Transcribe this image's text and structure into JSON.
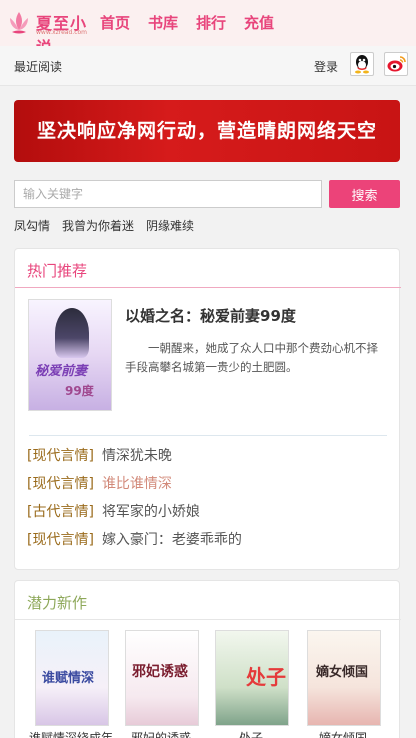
{
  "header": {
    "logo_text": "夏至小说",
    "logo_sub": "www.xzread.com",
    "nav": [
      "首页",
      "书库",
      "排行",
      "充值"
    ]
  },
  "subbar": {
    "recent": "最近阅读",
    "login": "登录"
  },
  "banner": {
    "text": "坚决响应净网行动，营造晴朗网络天空"
  },
  "search": {
    "placeholder": "输入关键字",
    "button": "搜索",
    "hot_tags": [
      "凤勾情",
      "我曾为你着迷",
      "阴缘难续"
    ]
  },
  "recommend": {
    "title": "热门推荐",
    "featured": {
      "title": "以婚之名：秘爱前妻99度",
      "desc": "一朝醒来，她成了众人口中那个费劲心机不择手段高攀名城第一贵少的土肥圆。",
      "cover_title": "秘爱前妻",
      "cover_sub": "99度"
    },
    "list": [
      {
        "cat": "[现代言情]",
        "name": "情深犹未晚"
      },
      {
        "cat": "[现代言情]",
        "name": "谁比谁情深"
      },
      {
        "cat": "[古代言情]",
        "name": "将军家的小娇娘"
      },
      {
        "cat": "[现代言情]",
        "name": "嫁入豪门：老婆乖乖的"
      }
    ]
  },
  "new_works": {
    "title": "潜力新作",
    "books": [
      {
        "cover": "谁赋情深",
        "caption": "谁赋情深绕成年"
      },
      {
        "cover": "邪妃诱惑",
        "caption": "邪妃的诱惑"
      },
      {
        "cover": "处子",
        "caption": "处子"
      },
      {
        "cover": "嫡女倾国",
        "caption": "嫡女倾国"
      }
    ]
  },
  "colors": {
    "accent": "#e8457c",
    "banner": "#c81414",
    "green_title": "#8ea85a",
    "category": "#9a6b1c"
  },
  "icons": [
    "qq-icon",
    "weibo-icon",
    "lotus-logo-icon"
  ]
}
